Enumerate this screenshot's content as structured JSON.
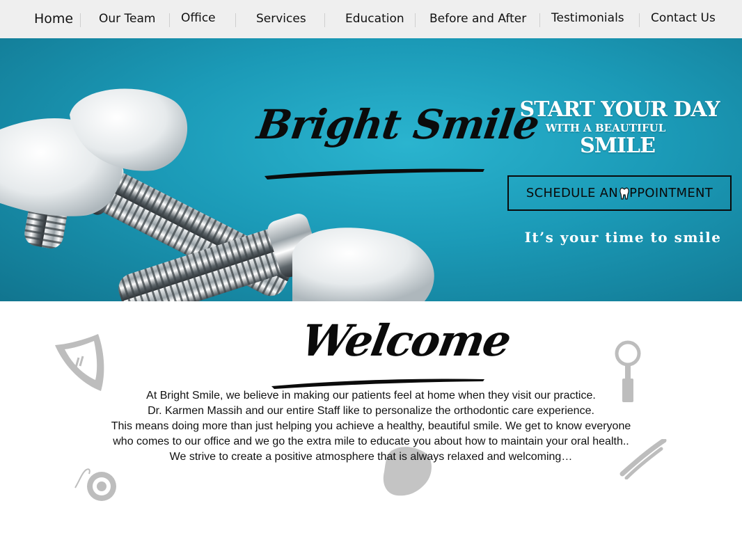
{
  "nav": {
    "items": [
      {
        "label": "Home"
      },
      {
        "label": "Our Team"
      },
      {
        "label": "Office"
      },
      {
        "label": "Services"
      },
      {
        "label": "Education"
      },
      {
        "label": "Before and After"
      },
      {
        "label": "Testimonials"
      },
      {
        "label": "Contact Us"
      }
    ]
  },
  "hero": {
    "brand": "Bright Smile",
    "tagline": {
      "line1": "START YOUR DAY",
      "line2": "WITH A BEAUTIFUL",
      "line3": "SMILE"
    },
    "appointment_button": {
      "before_icon": "SCHEDULE AN",
      "icon": "tooth-icon",
      "after_icon": "PPOINTMENT"
    },
    "slogan": "It’s your time to smile"
  },
  "welcome": {
    "title": "Welcome",
    "paragraph": [
      "At Bright Smile, we believe in making our patients feel at home when they visit our practice.",
      "Dr. Karmen Massih and our entire Staff like to personalize the orthodontic care experience.",
      "This means doing more than just helping you achieve a healthy, beautiful smile. We get to know everyone",
      "who comes to our office and we go the extra mile to educate you about how to maintain your oral health..",
      "We strive to create a positive atmosphere that is always relaxed and welcoming…"
    ],
    "icons": [
      "shield-icon",
      "dental-mirror-icon",
      "dental-floss-icon",
      "tooth-icon",
      "dental-forceps-icon"
    ]
  },
  "colors": {
    "nav_background": "#efefef",
    "hero_teal": "#1b9ab7",
    "icon_grey": "#bdbdbd",
    "text_dark": "#111111",
    "white": "#ffffff"
  }
}
